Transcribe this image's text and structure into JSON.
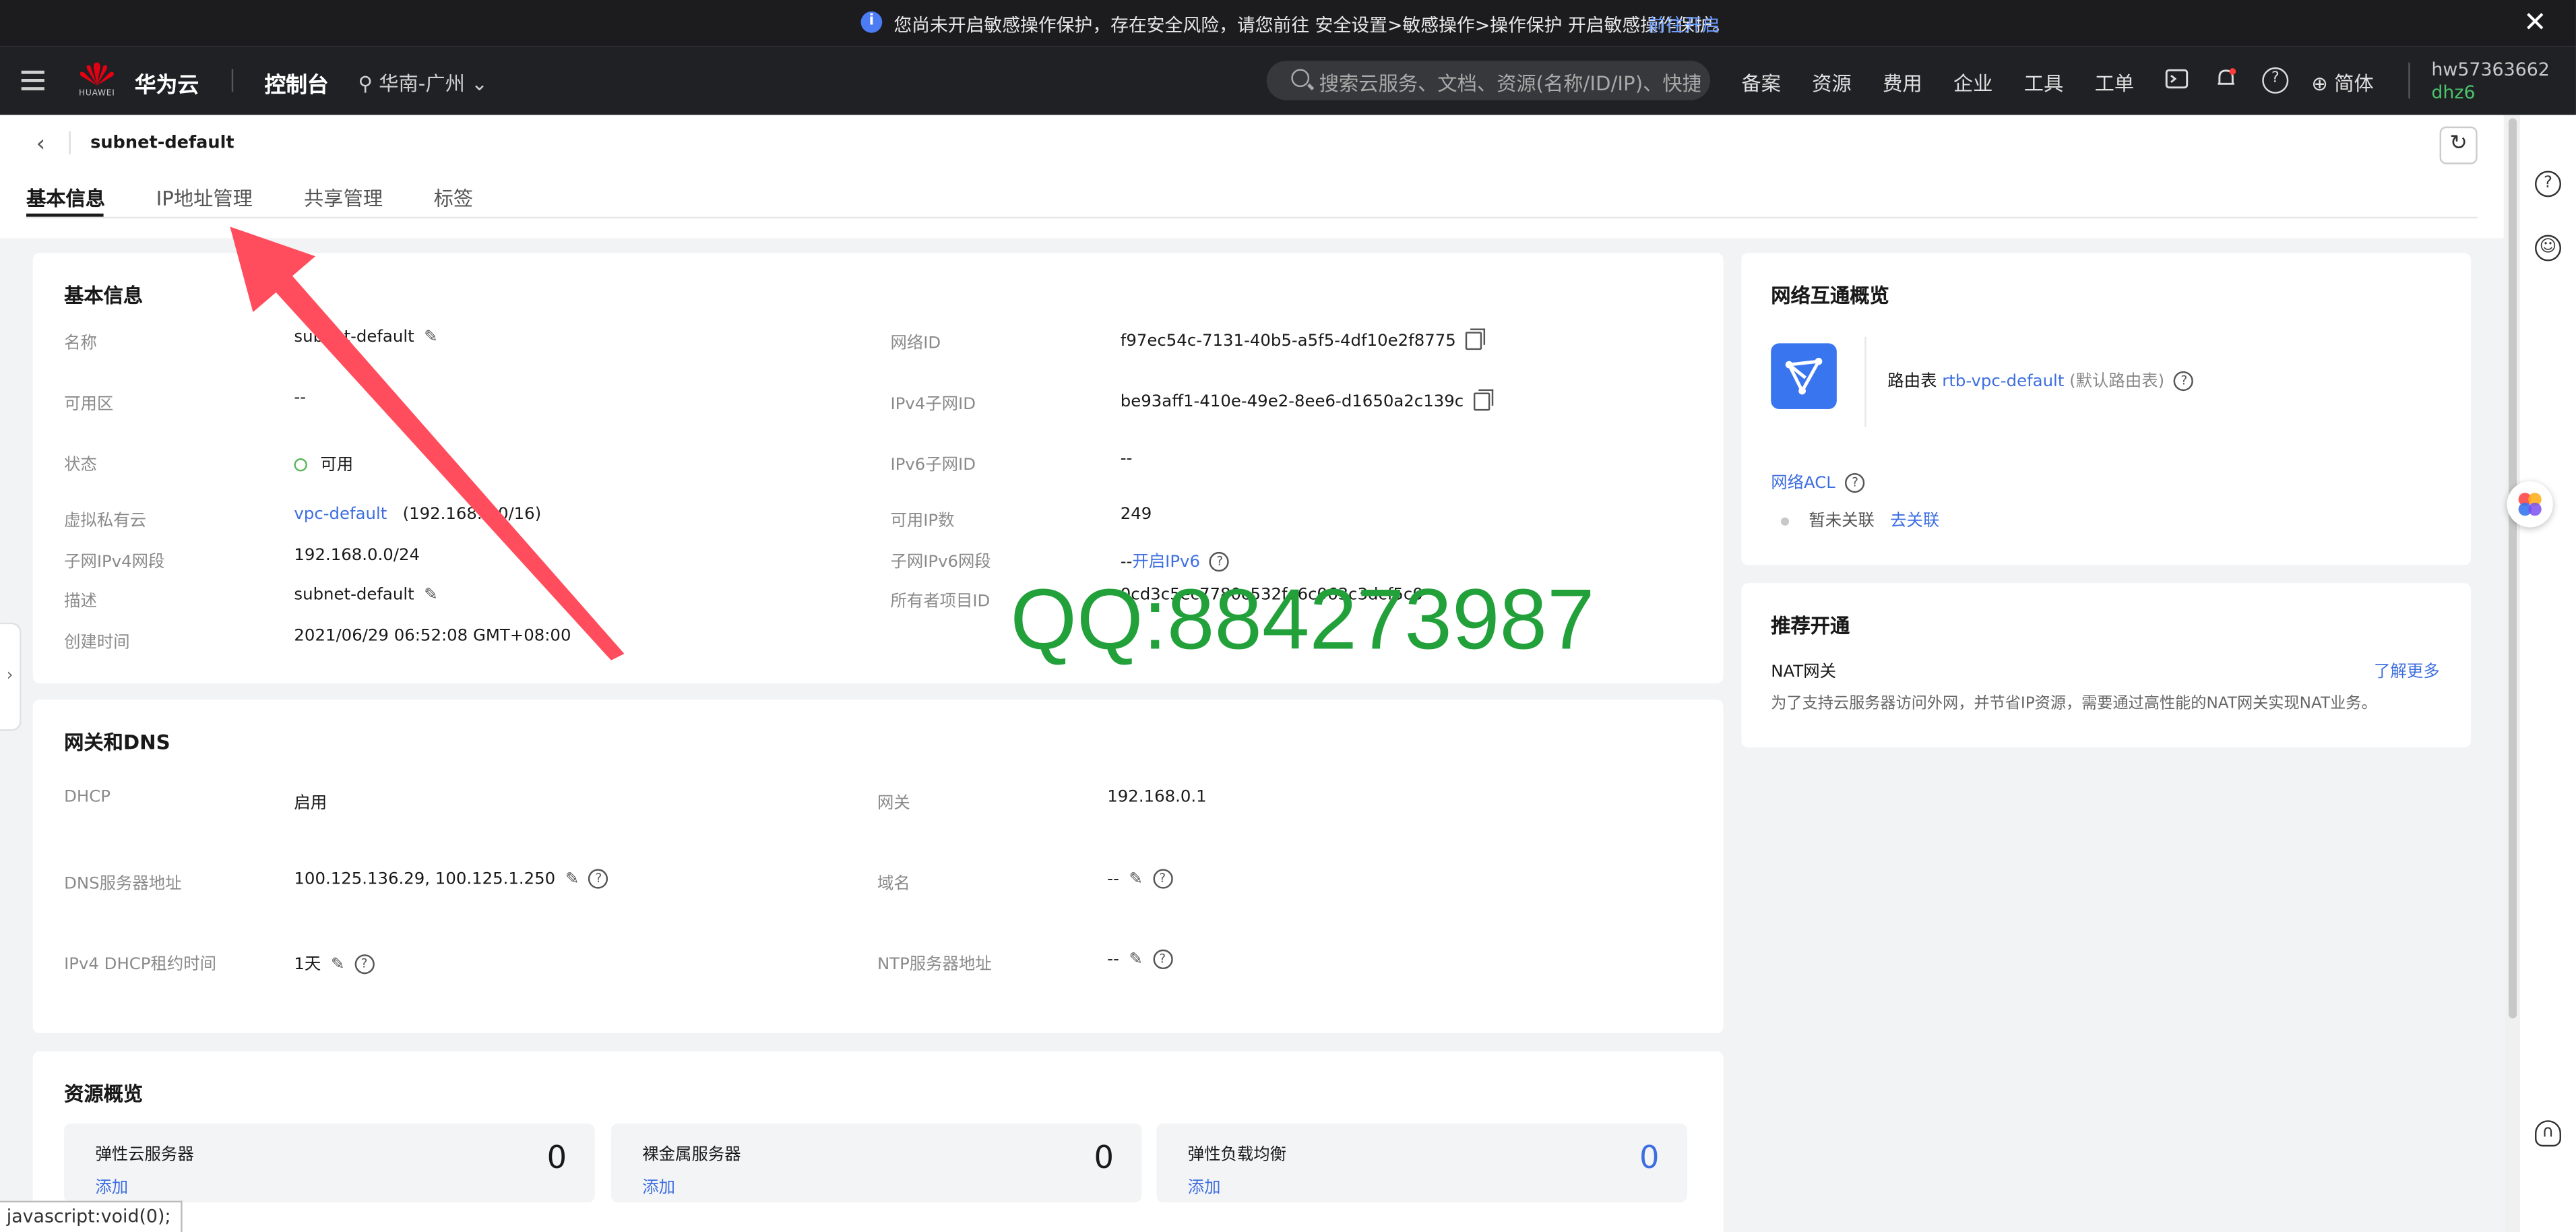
{
  "banner": {
    "text": "您尚未开启敏感操作保护，存在安全风险，请您前往 安全设置>敏感操作>操作保护 开启敏感操作保护。",
    "link": "前往开启"
  },
  "nav": {
    "brand": "华为云",
    "logo_sub": "HUAWEI",
    "console": "控制台",
    "region": "华南-广州",
    "search_placeholder": "搜索云服务、文档、资源(名称/ID/IP)、快捷键",
    "menu": [
      "备案",
      "资源",
      "费用",
      "企业",
      "工具",
      "工单"
    ],
    "lang": "简体",
    "user_name": "hw57363662",
    "user_sub": "dhz6"
  },
  "page": {
    "title": "subnet-default",
    "tabs": [
      "基本信息",
      "IP地址管理",
      "共享管理",
      "标签"
    ]
  },
  "basic_info": {
    "heading": "基本信息",
    "left": [
      {
        "label": "名称",
        "value": "subnet-default"
      },
      {
        "label": "可用区",
        "value": "--"
      },
      {
        "label": "状态",
        "value": "可用"
      },
      {
        "label": "虚拟私有云",
        "value": "vpc-default",
        "extra": "(192.168.0.0/16)"
      },
      {
        "label": "子网IPv4网段",
        "value": "192.168.0.0/24"
      },
      {
        "label": "描述",
        "value": "subnet-default"
      },
      {
        "label": "创建时间",
        "value": "2021/06/29 06:52:08 GMT+08:00"
      }
    ],
    "right": [
      {
        "label": "网络ID",
        "value": "f97ec54c-7131-40b5-a5f5-4df10e2f8775"
      },
      {
        "label": "IPv4子网ID",
        "value": "be93aff1-410e-49e2-8ee6-d1650a2c139c"
      },
      {
        "label": "IPv6子网ID",
        "value": "--"
      },
      {
        "label": "可用IP数",
        "value": "249"
      },
      {
        "label": "子网IPv6网段",
        "value": "--",
        "link": "开启IPv6"
      },
      {
        "label": "所有者项目ID",
        "value": "0cd3c5ec7780c532fe6c063c3dcf5c0"
      }
    ]
  },
  "gateway_dns": {
    "heading": "网关和DNS",
    "left": [
      {
        "label": "DHCP",
        "value": "启用"
      },
      {
        "label": "DNS服务器地址",
        "value": "100.125.136.29, 100.125.1.250"
      },
      {
        "label": "IPv4 DHCP租约时间",
        "value": "1天"
      }
    ],
    "right": [
      {
        "label": "网关",
        "value": "192.168.0.1"
      },
      {
        "label": "域名",
        "value": "--"
      },
      {
        "label": "NTP服务器地址",
        "value": "--"
      }
    ]
  },
  "resources": {
    "heading": "资源概览",
    "items": [
      {
        "name": "弹性云服务器",
        "action": "添加",
        "count": "0"
      },
      {
        "name": "裸金属服务器",
        "action": "添加",
        "count": "0"
      },
      {
        "name": "弹性负载均衡",
        "action": "添加",
        "count": "0"
      }
    ]
  },
  "network_overview": {
    "heading": "网络互通概览",
    "route_label": "路由表",
    "route_link": "rtb-vpc-default",
    "route_note": "(默认路由表)",
    "acl_link": "网络ACL",
    "acl_status": "暂未关联",
    "acl_action": "去关联"
  },
  "recommend": {
    "heading": "推荐开通",
    "item": "NAT网关",
    "more": "了解更多",
    "desc": "为了支持云服务器访问外网，并节省IP资源，需要通过高性能的NAT网关实现NAT业务。"
  },
  "watermark": "QQ:884273987",
  "status_bar": "javascript:void(0);",
  "colors": {
    "link": "#3d6ee0",
    "accent_red": "#ff4d5e",
    "watermark": "#22a03a",
    "icon_blue": "#3a75f0"
  }
}
